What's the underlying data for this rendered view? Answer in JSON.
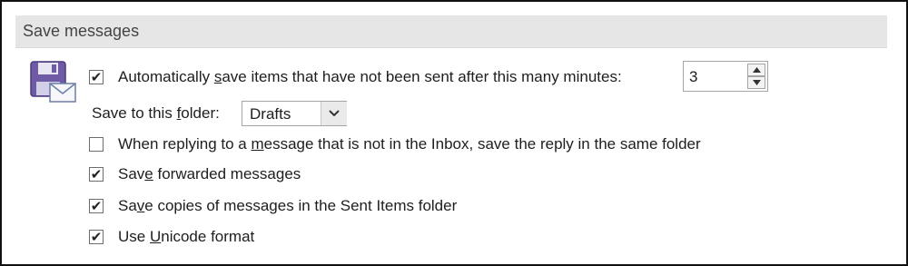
{
  "section": {
    "title": "Save messages"
  },
  "icon": {
    "name": "save-mail-icon"
  },
  "autosave": {
    "label_pre": "Automatically ",
    "label_key": "s",
    "label_post": "ave items that have not been sent after this many minutes:",
    "checked": true,
    "minutes": "3"
  },
  "folder": {
    "label_pre": "Save to this ",
    "label_key": "f",
    "label_post": "older:",
    "value": "Drafts"
  },
  "options": [
    {
      "pre": "When replying to a ",
      "key": "m",
      "post": "essage that is not in the Inbox, save the reply in the same folder",
      "checked": false
    },
    {
      "pre": "Sav",
      "key": "e",
      "post": " forwarded messages",
      "checked": true
    },
    {
      "pre": "Sa",
      "key": "v",
      "post": "e copies of messages in the Sent Items folder",
      "checked": true
    },
    {
      "pre": "Use ",
      "key": "U",
      "post": "nicode format",
      "checked": true
    }
  ]
}
